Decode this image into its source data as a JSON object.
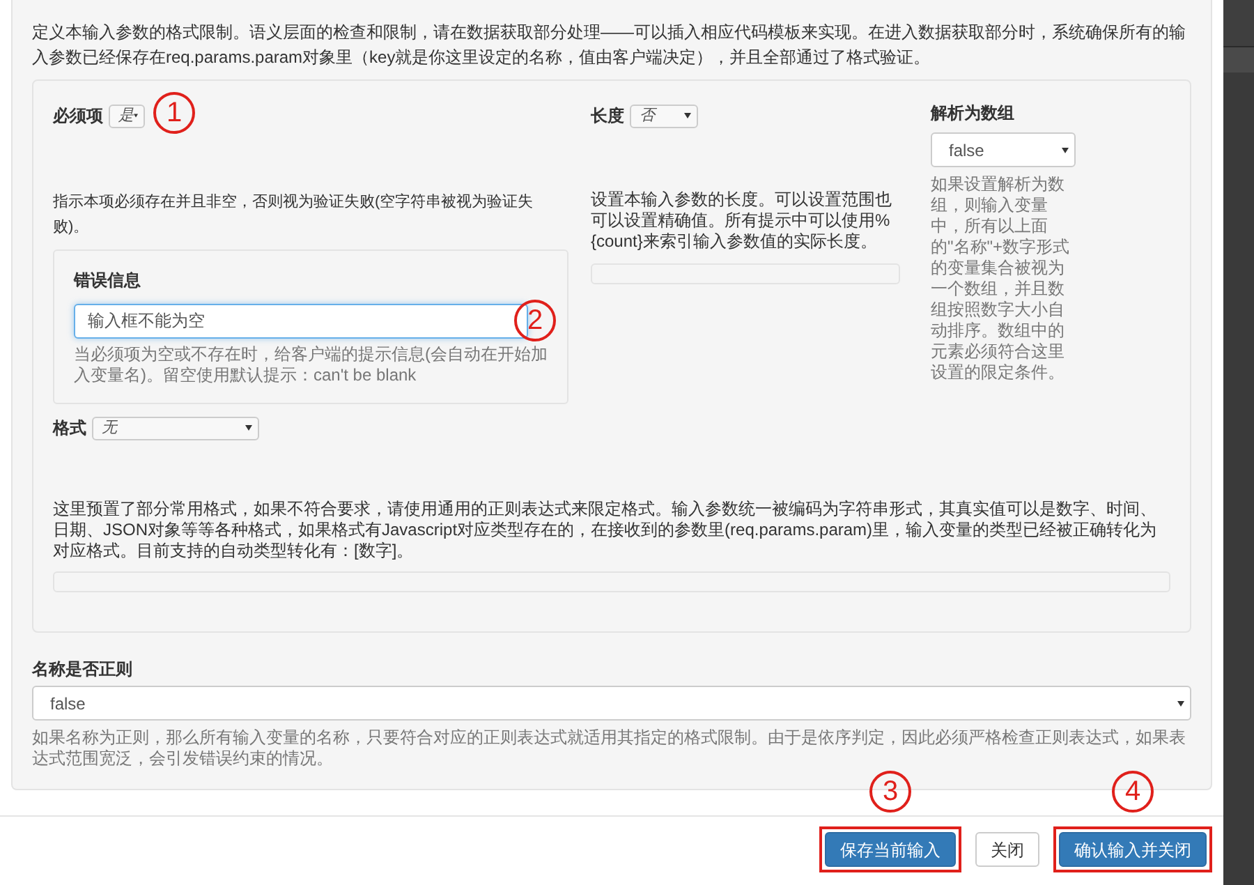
{
  "description": "定义本输入参数的格式限制。语义层面的检查和限制，请在数据获取部分处理——可以插入相应代码模板来实现。在进入数据获取部分时，系统确保所有的输入参数已经保存在req.params.param对象里（key就是你这里设定的名称，值由客户端决定），并且全部通过了格式验证。",
  "required": {
    "label": "必须项",
    "value": "是",
    "help": "指示本项必须存在并且非空，否则视为验证失败(空字符串被视为验证失败)。",
    "marker": "1"
  },
  "error_message": {
    "label": "错误信息",
    "value": "输入框不能为空",
    "help": "当必须项为空或不存在时，给客户端的提示信息(会自动在开始加入变量名)。留空使用默认提示：can't be blank",
    "marker": "2"
  },
  "length": {
    "label": "长度",
    "value": "否",
    "help": "设置本输入参数的长度。可以设置范围也可以设置精确值。所有提示中可以使用%{count}来索引输入参数值的实际长度。"
  },
  "parse_array": {
    "label": "解析为数组",
    "value": "false",
    "help": "如果设置解析为数组，则输入变量中，所有以上面的\"名称\"+数字形式的变量集合被视为一个数组，并且数组按照数字大小自动排序。数组中的元素必须符合这里设置的限定条件。"
  },
  "format": {
    "label": "格式",
    "value": "无",
    "help": "这里预置了部分常用格式，如果不符合要求，请使用通用的正则表达式来限定格式。输入参数统一被编码为字符串形式，其真实值可以是数字、时间、日期、JSON对象等等各种格式，如果格式有Javascript对应类型存在的，在接收到的参数里(req.params.param)里，输入变量的类型已经被正确转化为对应格式。目前支持的自动类型转化有：[数字]。"
  },
  "name_regex": {
    "label": "名称是否正则",
    "value": "false",
    "help": "如果名称为正则，那么所有输入变量的名称，只要符合对应的正则表达式就适用其指定的格式限制。由于是依序判定，因此必须严格检查正则表达式，如果表达式范围宽泛，会引发错误约束的情况。"
  },
  "buttons": [
    {
      "label": "保存当前输入",
      "kind": "primary",
      "marker": "3"
    },
    {
      "label": "关闭",
      "kind": "default"
    },
    {
      "label": "确认输入并关闭",
      "kind": "primary",
      "marker": "4"
    }
  ]
}
